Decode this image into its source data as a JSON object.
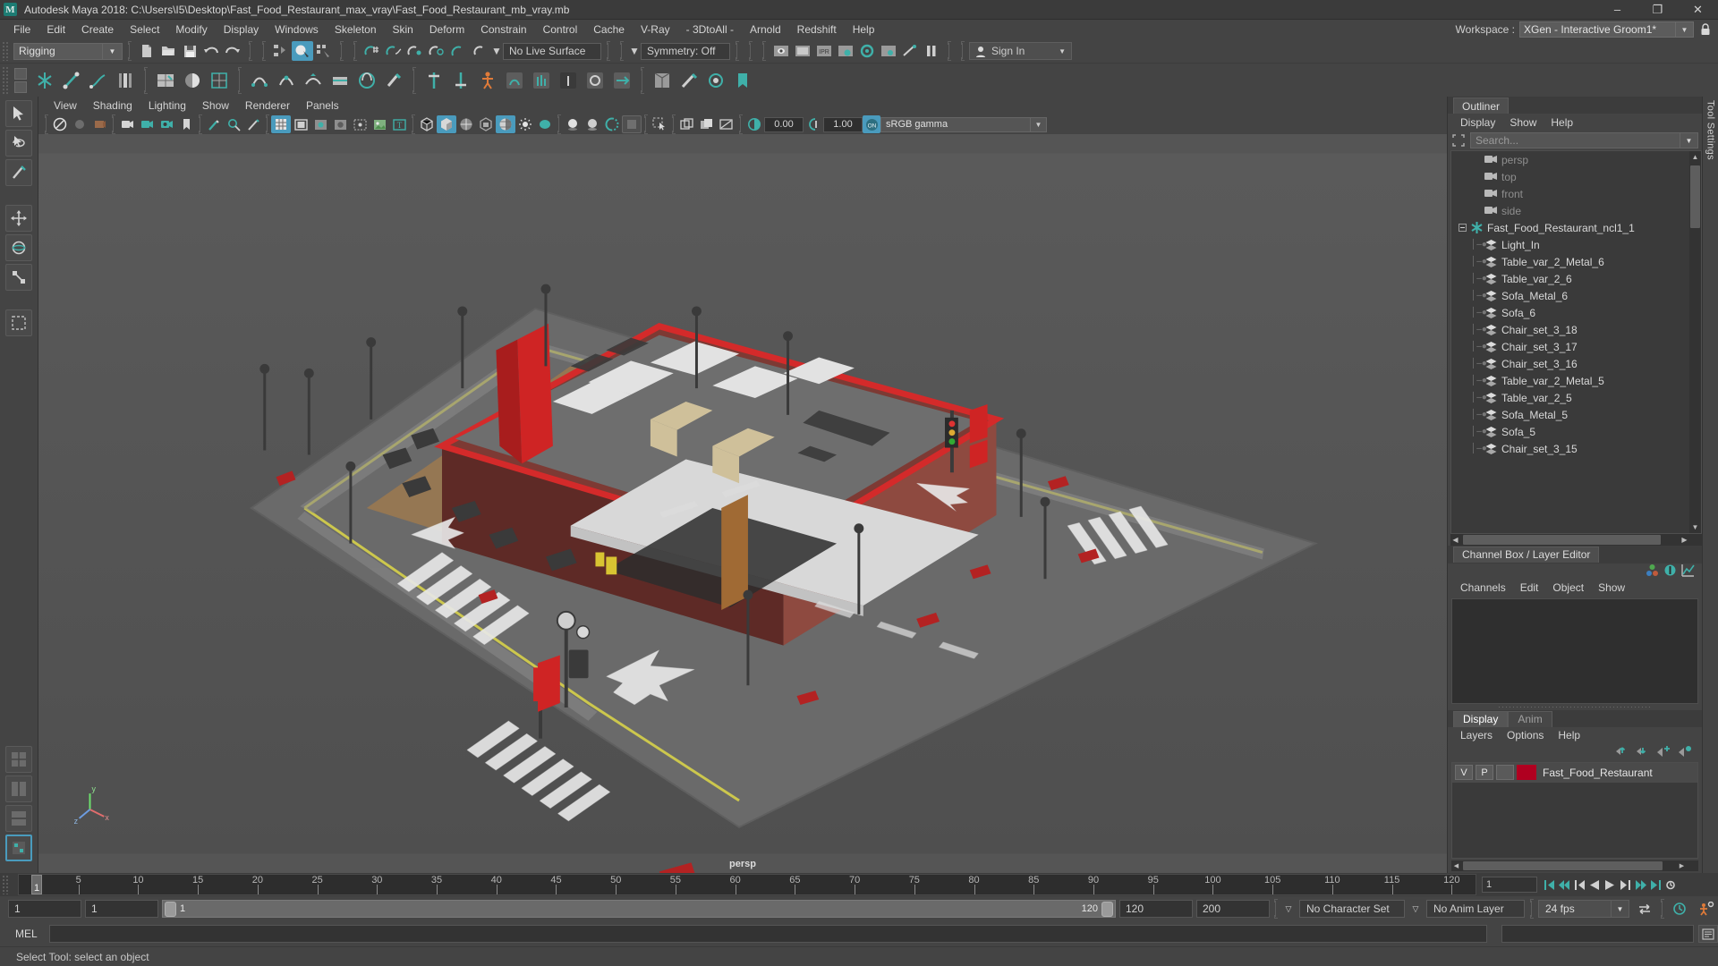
{
  "window": {
    "title": "Autodesk Maya 2018: C:\\Users\\I5\\Desktop\\Fast_Food_Restaurant_max_vray\\Fast_Food_Restaurant_mb_vray.mb",
    "logo_letter": "M",
    "minimize": "–",
    "maximize": "❐",
    "close": "✕"
  },
  "menubar": {
    "items": [
      "File",
      "Edit",
      "Create",
      "Select",
      "Modify",
      "Display",
      "Windows",
      "Skeleton",
      "Skin",
      "Deform",
      "Constrain",
      "Control",
      "Cache",
      "V-Ray",
      "- 3DtoAll -",
      "Arnold",
      "Redshift",
      "Help"
    ],
    "workspace_label": "Workspace :",
    "workspace_value": "XGen - Interactive Groom1*"
  },
  "statusline": {
    "menu_set": "Rigging",
    "live_surface": "No Live Surface",
    "symmetry": "Symmetry: Off",
    "signin": "Sign In"
  },
  "viewport": {
    "menus": [
      "View",
      "Shading",
      "Lighting",
      "Show",
      "Renderer",
      "Panels"
    ],
    "exposure": "0.00",
    "gamma": "1.00",
    "color_management": "sRGB gamma",
    "camera_label": "persp",
    "axis_x": "x",
    "axis_y": "y",
    "axis_z": "z"
  },
  "outliner": {
    "tab": "Outliner",
    "menus": [
      "Display",
      "Show",
      "Help"
    ],
    "search_placeholder": "Search...",
    "items": [
      {
        "label": "persp",
        "icon": "camera-icon",
        "depth": 1,
        "dim": true
      },
      {
        "label": "top",
        "icon": "camera-icon",
        "depth": 1,
        "dim": true
      },
      {
        "label": "front",
        "icon": "camera-icon",
        "depth": 1,
        "dim": true
      },
      {
        "label": "side",
        "icon": "camera-icon",
        "depth": 1,
        "dim": true
      },
      {
        "label": "Fast_Food_Restaurant_ncl1_1",
        "icon": "asterisk-icon",
        "depth": 0,
        "dim": false,
        "expander": "minus"
      },
      {
        "label": "Light_In",
        "icon": "mesh-icon",
        "depth": 1,
        "dim": false
      },
      {
        "label": "Table_var_2_Metal_6",
        "icon": "mesh-icon",
        "depth": 1,
        "dim": false
      },
      {
        "label": "Table_var_2_6",
        "icon": "mesh-icon",
        "depth": 1,
        "dim": false
      },
      {
        "label": "Sofa_Metal_6",
        "icon": "mesh-icon",
        "depth": 1,
        "dim": false
      },
      {
        "label": "Sofa_6",
        "icon": "mesh-icon",
        "depth": 1,
        "dim": false
      },
      {
        "label": "Chair_set_3_18",
        "icon": "mesh-icon",
        "depth": 1,
        "dim": false
      },
      {
        "label": "Chair_set_3_17",
        "icon": "mesh-icon",
        "depth": 1,
        "dim": false
      },
      {
        "label": "Chair_set_3_16",
        "icon": "mesh-icon",
        "depth": 1,
        "dim": false
      },
      {
        "label": "Table_var_2_Metal_5",
        "icon": "mesh-icon",
        "depth": 1,
        "dim": false
      },
      {
        "label": "Table_var_2_5",
        "icon": "mesh-icon",
        "depth": 1,
        "dim": false
      },
      {
        "label": "Sofa_Metal_5",
        "icon": "mesh-icon",
        "depth": 1,
        "dim": false
      },
      {
        "label": "Sofa_5",
        "icon": "mesh-icon",
        "depth": 1,
        "dim": false
      },
      {
        "label": "Chair_set_3_15",
        "icon": "mesh-icon",
        "depth": 1,
        "dim": false
      }
    ]
  },
  "channelbox": {
    "tab": "Channel Box / Layer Editor",
    "menus": [
      "Channels",
      "Edit",
      "Object",
      "Show"
    ]
  },
  "layers": {
    "tabs": [
      {
        "label": "Display",
        "active": true
      },
      {
        "label": "Anim",
        "active": false
      }
    ],
    "menus": [
      "Layers",
      "Options",
      "Help"
    ],
    "rows": [
      {
        "visible": "V",
        "playback": "P",
        "state": "",
        "color": "#b00020",
        "name": "Fast_Food_Restaurant"
      }
    ]
  },
  "tool_settings_tab": "Tool Settings",
  "timeline": {
    "ticks": [
      5,
      10,
      15,
      20,
      25,
      30,
      35,
      40,
      45,
      50,
      55,
      60,
      65,
      70,
      75,
      80,
      85,
      90,
      95,
      100,
      105,
      110,
      115,
      120
    ],
    "current_frame": "1",
    "playback_field": "1",
    "range_start": "1",
    "range_end": "1",
    "slider_start": "1",
    "slider_end": "120",
    "anim_end": "120",
    "anim_max": "200",
    "character_set": "No Character Set",
    "anim_layer": "No Anim Layer",
    "fps": "24 fps"
  },
  "command": {
    "label": "MEL",
    "value": ""
  },
  "statusbar": {
    "message": "Select Tool: select an object"
  },
  "colors": {
    "accent": "#4a9bbd",
    "teal": "#3fb0a9",
    "layer_red": "#b00020",
    "panel_bg": "#444444",
    "viewport_bg": "#555555"
  }
}
